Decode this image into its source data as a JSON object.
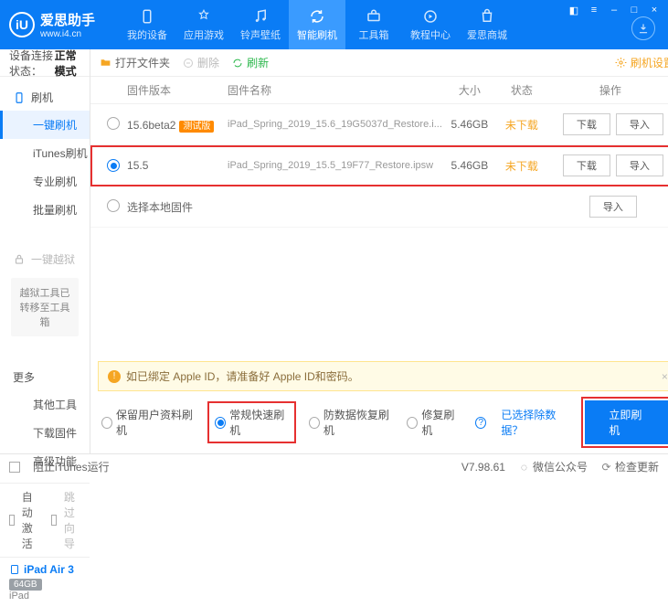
{
  "brand": {
    "name": "爱思助手",
    "url": "www.i4.cn",
    "logo_letter": "iU"
  },
  "nav": [
    {
      "label": "我的设备"
    },
    {
      "label": "应用游戏"
    },
    {
      "label": "铃声壁纸"
    },
    {
      "label": "智能刷机"
    },
    {
      "label": "工具箱"
    },
    {
      "label": "教程中心"
    },
    {
      "label": "爱思商城"
    }
  ],
  "sidebar": {
    "status_label": "设备连接状态：",
    "status_value": "正常模式",
    "group1": {
      "head": "刷机",
      "items": [
        "一键刷机",
        "iTunes刷机",
        "专业刷机",
        "批量刷机"
      ]
    },
    "group2": {
      "head": "一键越狱",
      "note": "越狱工具已转移至工具箱"
    },
    "group3": {
      "head": "更多",
      "items": [
        "其他工具",
        "下载固件",
        "高级功能"
      ]
    },
    "auto_activate": "自动激活",
    "skip_guide": "跳过向导",
    "device": {
      "name": "iPad Air 3",
      "storage": "64GB",
      "type": "iPad"
    }
  },
  "toolbar": {
    "open": "打开文件夹",
    "delete": "删除",
    "refresh": "刷新",
    "settings": "刷机设置"
  },
  "thead": {
    "ver": "固件版本",
    "name": "固件名称",
    "size": "大小",
    "status": "状态",
    "ops": "操作"
  },
  "rows": [
    {
      "ver": "15.6beta2",
      "tag": "测试版",
      "name": "iPad_Spring_2019_15.6_19G5037d_Restore.i...",
      "size": "5.46GB",
      "status": "未下载"
    },
    {
      "ver": "15.5",
      "tag": "",
      "name": "iPad_Spring_2019_15.5_19F77_Restore.ipsw",
      "size": "5.46GB",
      "status": "未下载"
    }
  ],
  "local_row": "选择本地固件",
  "btns": {
    "download": "下载",
    "import": "导入"
  },
  "warn": "如已绑定 Apple ID，请准备好 Apple ID和密码。",
  "opts": [
    "保留用户资料刷机",
    "常规快速刷机",
    "防数据恢复刷机",
    "修复刷机"
  ],
  "exclude_link": "已选择除数据？",
  "flash_btn": "立即刷机",
  "footer": {
    "block_itunes": "阻止iTunes运行",
    "version": "V7.98.61",
    "wechat": "微信公众号",
    "update": "检查更新"
  }
}
